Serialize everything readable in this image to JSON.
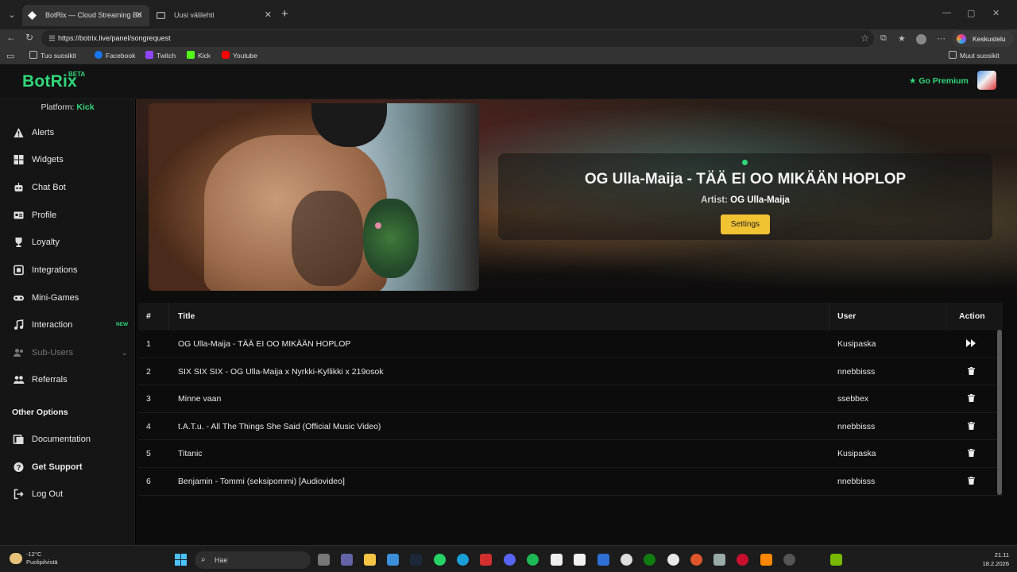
{
  "browser": {
    "tabs": [
      {
        "title": "BotRix — Cloud Streaming Bo",
        "active": true
      },
      {
        "title": "Uusi välilehti",
        "active": false
      }
    ],
    "url": "https://botrix.live/panel/songrequest",
    "profile_label": "Keskustelu",
    "bookmarks": [
      {
        "label": "Tuo suosikit",
        "icon": "import-icon"
      },
      {
        "label": "Facebook",
        "icon": "facebook-icon",
        "color": "#1877f2"
      },
      {
        "label": "Twitch",
        "icon": "twitch-icon",
        "color": "#9146ff"
      },
      {
        "label": "Kick",
        "icon": "kick-icon",
        "color": "#53fc18"
      },
      {
        "label": "Youtube",
        "icon": "youtube-icon",
        "color": "#ff0000"
      }
    ],
    "other_bookmarks": "Muut suosikit"
  },
  "app": {
    "brand": "BotRix",
    "beta": "BETA",
    "premium": "Go Premium",
    "accent": "#31d87a"
  },
  "sidebar": {
    "platform_label": "Platform:",
    "platform_value": "Kick",
    "items": [
      {
        "label": "Alerts",
        "icon": "alert-triangle-icon"
      },
      {
        "label": "Widgets",
        "icon": "widgets-grid-icon"
      },
      {
        "label": "Chat Bot",
        "icon": "robot-icon"
      },
      {
        "label": "Profile",
        "icon": "id-card-icon"
      },
      {
        "label": "Loyalty",
        "icon": "trophy-icon"
      },
      {
        "label": "Integrations",
        "icon": "integration-icon"
      },
      {
        "label": "Mini-Games",
        "icon": "gamepad-icon"
      },
      {
        "label": "Interaction",
        "icon": "music-note-icon",
        "badge": "NEW"
      },
      {
        "label": "Sub-Users",
        "icon": "users-icon",
        "disabled": true
      },
      {
        "label": "Referrals",
        "icon": "referrals-icon"
      }
    ],
    "other_options_title": "Other Options",
    "other_items": [
      {
        "label": "Documentation",
        "icon": "documentation-icon"
      },
      {
        "label": "Get Support",
        "icon": "help-circle-icon"
      },
      {
        "label": "Log Out",
        "icon": "logout-icon"
      }
    ]
  },
  "now_playing": {
    "title": "OG Ulla-Maija - TÄÄ EI OO MIKÄÄN HOPLOP",
    "artist_label": "Artist:",
    "artist": "OG Ulla-Maija",
    "settings_label": "Settings"
  },
  "queue": {
    "headers": {
      "num": "#",
      "title": "Title",
      "user": "User",
      "action": "Action"
    },
    "rows": [
      {
        "num": "1",
        "title": "OG Ulla-Maija - TÄÄ EI OO MIKÄÄN HOPLOP",
        "user": "Kusipaska",
        "action": "skip-icon"
      },
      {
        "num": "2",
        "title": "SIX SIX SIX - OG Ulla-Maija x Nyrkki-Kyllikki x 219osok",
        "user": "nnebbisss",
        "action": "trash-icon"
      },
      {
        "num": "3",
        "title": "Minne vaan",
        "user": "ssebbex",
        "action": "trash-icon"
      },
      {
        "num": "4",
        "title": "t.A.T.u. - All The Things She Said (Official Music Video)",
        "user": "nnebbisss",
        "action": "trash-icon"
      },
      {
        "num": "5",
        "title": "Titanic",
        "user": "Kusipaska",
        "action": "trash-icon"
      },
      {
        "num": "6",
        "title": "Benjamin - Tommi (seksipommi) [Audiovideo]",
        "user": "nnebbisss",
        "action": "trash-icon"
      }
    ]
  },
  "taskbar": {
    "weather_temp": "-12°C",
    "weather_desc": "Puolipilvistä",
    "search_placeholder": "Hae",
    "time": "21.11",
    "date": "18.2.2026"
  }
}
